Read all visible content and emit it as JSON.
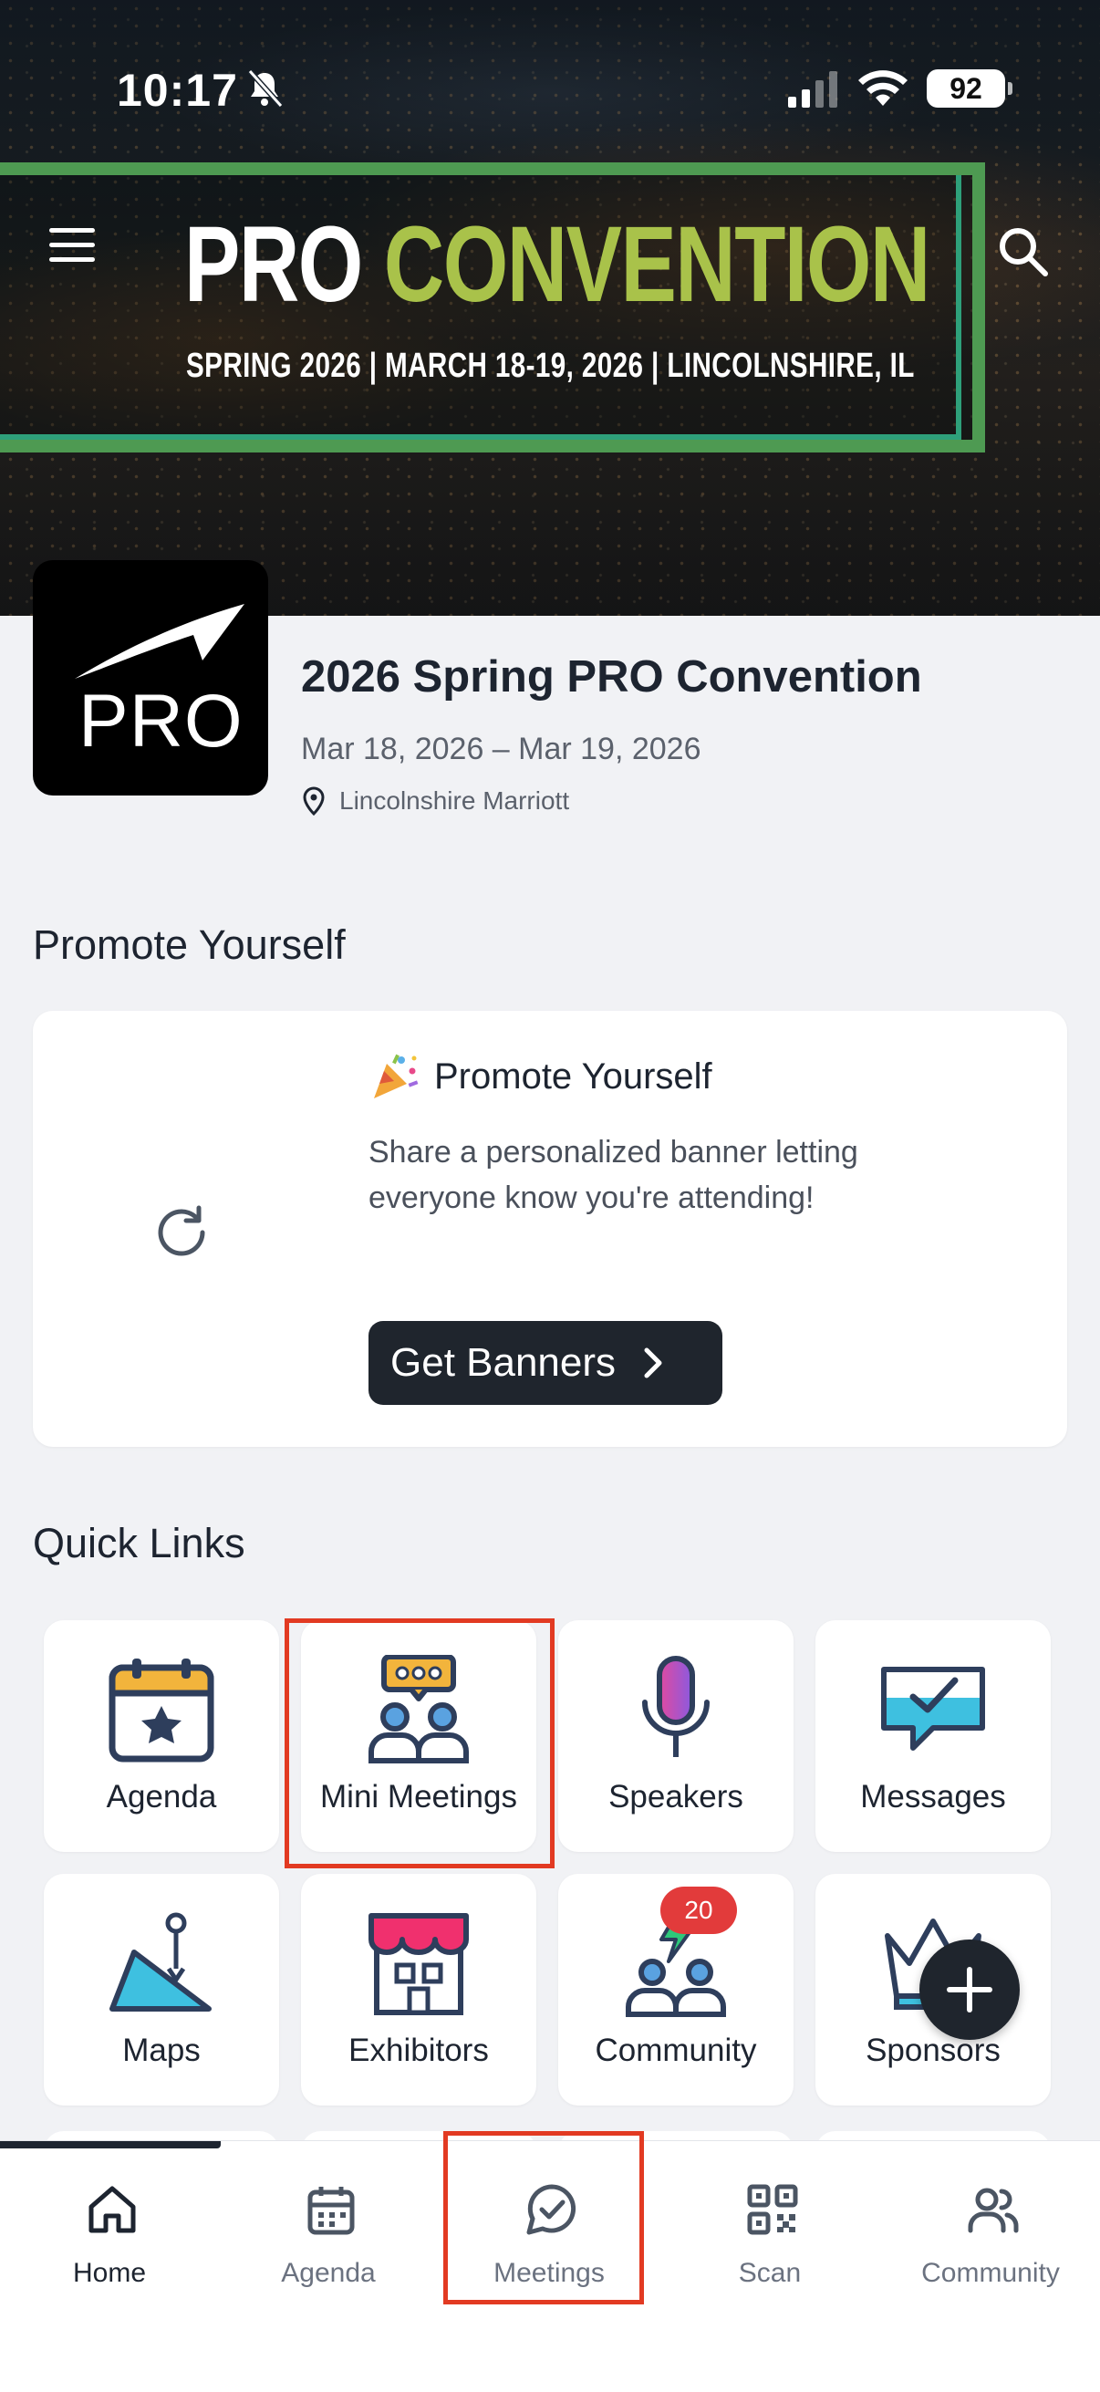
{
  "status_bar": {
    "time": "10:17",
    "battery": "92"
  },
  "banner": {
    "title_word1": "PRO",
    "title_word2": "CONVENTION",
    "subtitle": "SPRING 2026  |  MARCH 18-19, 2026  |  LINCOLNSHIRE, IL"
  },
  "event": {
    "logo_text": "PRO",
    "title": "2026 Spring PRO Convention",
    "dates": "Mar 18, 2026 – Mar 19, 2026",
    "location": "Lincolnshire Marriott"
  },
  "promote": {
    "section_title": "Promote Yourself",
    "card_title": "Promote Yourself",
    "description": "Share a personalized banner letting everyone know you're attending!",
    "button_label": "Get Banners"
  },
  "quick_links": {
    "section_title": "Quick Links",
    "items": [
      {
        "label": "Agenda",
        "icon": "calendar-star-icon"
      },
      {
        "label": "Mini Meetings",
        "icon": "meeting-people-icon"
      },
      {
        "label": "Speakers",
        "icon": "microphone-icon"
      },
      {
        "label": "Messages",
        "icon": "chat-check-icon"
      },
      {
        "label": "Maps",
        "icon": "map-pin-icon"
      },
      {
        "label": "Exhibitors",
        "icon": "storefront-icon"
      },
      {
        "label": "Community",
        "icon": "community-people-icon",
        "badge": "20"
      },
      {
        "label": "Sponsors",
        "icon": "crown-icon"
      }
    ]
  },
  "tabbar": {
    "items": [
      {
        "label": "Home",
        "icon": "home-icon",
        "active": true
      },
      {
        "label": "Agenda",
        "icon": "calendar-icon"
      },
      {
        "label": "Meetings",
        "icon": "chat-check-icon"
      },
      {
        "label": "Scan",
        "icon": "qr-code-icon"
      },
      {
        "label": "Community",
        "icon": "people-icon"
      }
    ]
  },
  "colors": {
    "accent_green": "#a9c24a",
    "frame_green": "#4e9a52",
    "dark_button": "#1f252d",
    "badge_red": "#e23b3b",
    "highlight_red": "#e23a22"
  }
}
